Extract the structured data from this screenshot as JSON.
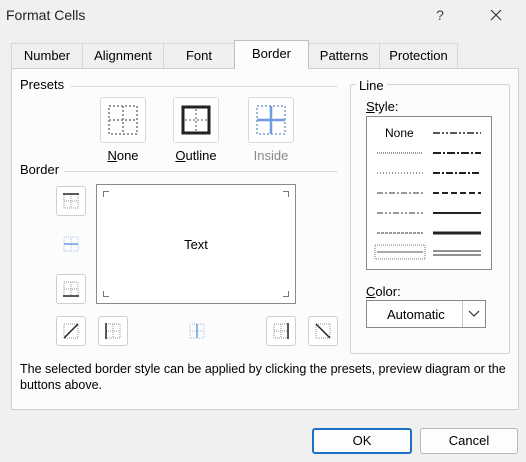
{
  "window": {
    "title": "Format Cells",
    "help_label": "?"
  },
  "tabs": [
    {
      "label": "Number"
    },
    {
      "label": "Alignment"
    },
    {
      "label": "Font"
    },
    {
      "label": "Border"
    },
    {
      "label": "Patterns"
    },
    {
      "label": "Protection"
    }
  ],
  "active_tab": "Border",
  "presets": {
    "heading": "Presets",
    "items": [
      {
        "label_underline": "N",
        "label_rest": "one"
      },
      {
        "label_underline": "O",
        "label_rest": "utline"
      },
      {
        "label": "Inside"
      }
    ]
  },
  "border": {
    "heading": "Border",
    "preview_text": "Text"
  },
  "line": {
    "heading": "Line",
    "style_label_underline": "S",
    "style_label_rest": "tyle:",
    "style_none": "None",
    "color_label_underline": "C",
    "color_label_rest": "olor:",
    "color_value": "Automatic",
    "selected_color": "#1f6fc5"
  },
  "info_text": "The selected border style can be applied by clicking the presets, preview diagram or the buttons above.",
  "buttons": {
    "ok": "OK",
    "cancel": "Cancel"
  },
  "icons": [
    "close-icon",
    "chevron-down-icon",
    "border-top-icon",
    "border-inner-horizontal-icon",
    "border-bottom-icon",
    "border-diagonal-up-icon",
    "border-left-icon",
    "border-inner-vertical-icon",
    "border-right-icon",
    "border-diagonal-down-icon"
  ]
}
